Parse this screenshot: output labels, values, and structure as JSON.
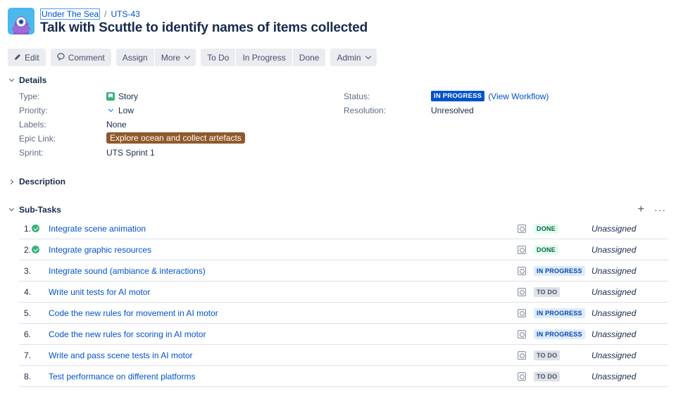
{
  "breadcrumb": {
    "project": "Under The Sea",
    "issue_key": "UTS-43"
  },
  "issue": {
    "title": "Talk with Scuttle to identify names of items collected"
  },
  "toolbar": {
    "edit": "Edit",
    "comment": "Comment",
    "assign": "Assign",
    "more": "More",
    "todo": "To Do",
    "in_progress": "In Progress",
    "done": "Done",
    "admin": "Admin"
  },
  "details": {
    "heading": "Details",
    "type_label": "Type:",
    "type_value": "Story",
    "priority_label": "Priority:",
    "priority_value": "Low",
    "labels_label": "Labels:",
    "labels_value": "None",
    "epic_label": "Epic Link:",
    "epic_value": "Explore ocean and collect artefacts",
    "sprint_label": "Sprint:",
    "sprint_value": "UTS Sprint 1",
    "status_label": "Status:",
    "status_value": "IN PROGRESS",
    "view_workflow": "(View Workflow)",
    "resolution_label": "Resolution:",
    "resolution_value": "Unresolved"
  },
  "description": {
    "heading": "Description"
  },
  "subtasks": {
    "heading": "Sub-Tasks",
    "items": [
      {
        "num": "1.",
        "summary": "Integrate scene animation",
        "status": "DONE",
        "assignee": "Unassigned"
      },
      {
        "num": "2.",
        "summary": "Integrate graphic resources",
        "status": "DONE",
        "assignee": "Unassigned"
      },
      {
        "num": "3.",
        "summary": "Integrate sound (ambiance & interactions)",
        "status": "IN PROGRESS",
        "assignee": "Unassigned"
      },
      {
        "num": "4.",
        "summary": "Write unit tests for AI motor",
        "status": "TO DO",
        "assignee": "Unassigned"
      },
      {
        "num": "5.",
        "summary": "Code the new rules for movement in AI motor",
        "status": "IN PROGRESS",
        "assignee": "Unassigned"
      },
      {
        "num": "6.",
        "summary": "Code the new rules for scoring in AI motor",
        "status": "IN PROGRESS",
        "assignee": "Unassigned"
      },
      {
        "num": "7.",
        "summary": "Write and pass scene tests in AI motor",
        "status": "TO DO",
        "assignee": "Unassigned"
      },
      {
        "num": "8.",
        "summary": "Test performance on different platforms",
        "status": "TO DO",
        "assignee": "Unassigned"
      }
    ]
  },
  "colors": {
    "link": "#0052cc",
    "epic": "#8f5a2a",
    "status_blue": "#0052cc",
    "done_green": "#36b37e"
  }
}
